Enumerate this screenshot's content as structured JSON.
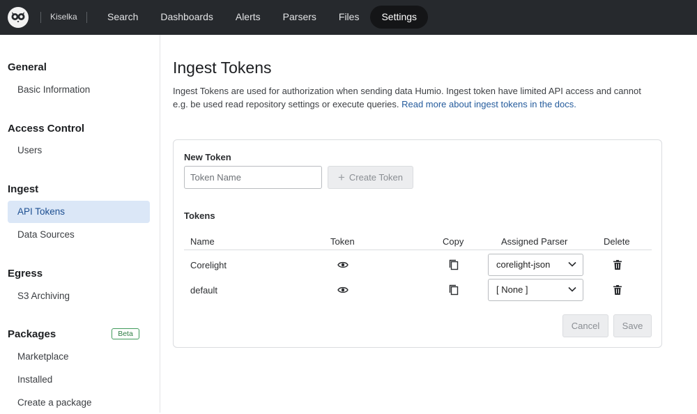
{
  "topbar": {
    "repo_name": "Kiselka",
    "nav": [
      {
        "label": "Search",
        "active": false
      },
      {
        "label": "Dashboards",
        "active": false
      },
      {
        "label": "Alerts",
        "active": false
      },
      {
        "label": "Parsers",
        "active": false
      },
      {
        "label": "Files",
        "active": false
      },
      {
        "label": "Settings",
        "active": true
      }
    ],
    "logo_icon": "owl-logo-icon"
  },
  "sidebar": {
    "sections": {
      "general": "General",
      "access_control": "Access Control",
      "ingest": "Ingest",
      "egress": "Egress",
      "packages": "Packages"
    },
    "items": {
      "basic_information": "Basic Information",
      "users": "Users",
      "api_tokens": "API Tokens",
      "data_sources": "Data Sources",
      "s3_archiving": "S3 Archiving",
      "marketplace": "Marketplace",
      "installed": "Installed",
      "create_package": "Create a package"
    },
    "active_item": "API Tokens",
    "beta_badge": "Beta"
  },
  "main": {
    "title": "Ingest Tokens",
    "intro_text": "Ingest Tokens are used for authorization when sending data Humio. Ingest token have limited API access and cannot e.g. be used read repository settings or execute queries.",
    "intro_link": "Read more about ingest tokens in the docs."
  },
  "new_token": {
    "label": "New Token",
    "input_placeholder": "Token Name",
    "input_value": "",
    "create_button": "Create Token"
  },
  "tokens": {
    "label": "Tokens",
    "columns": [
      "Name",
      "Token",
      "Copy",
      "Assigned Parser",
      "Delete"
    ],
    "rows": [
      {
        "name": "Corelight",
        "parser": "corelight-json"
      },
      {
        "name": "default",
        "parser": "[ None ]"
      }
    ],
    "row_icons": {
      "token": "eye-icon",
      "copy": "copy-icon",
      "delete": "trash-icon"
    }
  },
  "actions": {
    "cancel": "Cancel",
    "save": "Save"
  },
  "colors": {
    "topbar_bg": "#26292d",
    "active_nav_bg": "#141517",
    "sidebar_active_bg": "#dbe7f7",
    "link": "#245b9c",
    "beta_green": "#3f9a5a"
  }
}
